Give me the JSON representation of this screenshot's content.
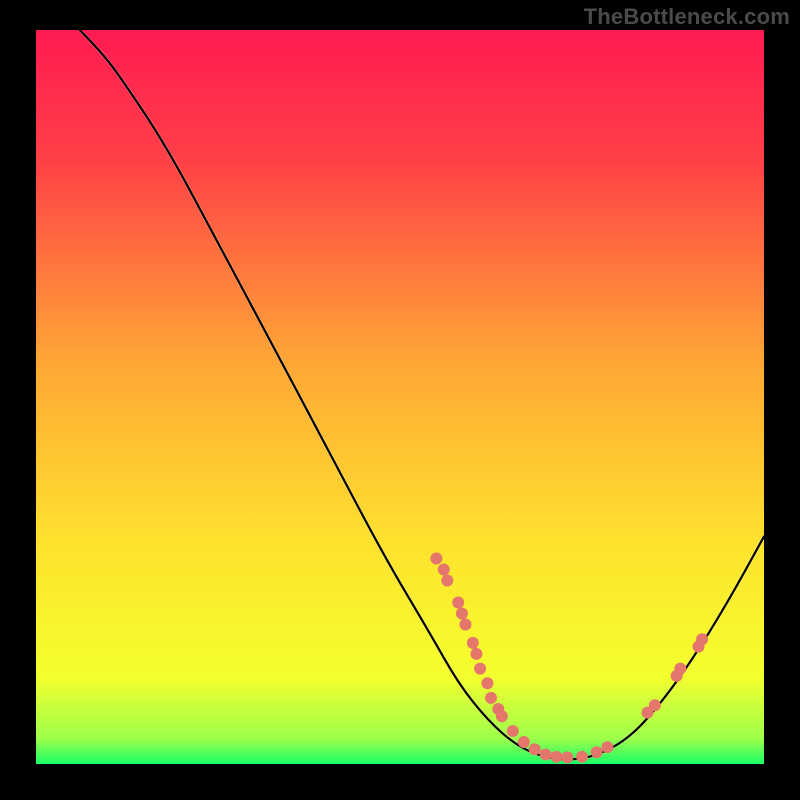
{
  "watermark": "TheBottleneck.com",
  "colors": {
    "dot": "#e4766b",
    "curve": "#000000"
  },
  "chart_data": {
    "type": "line",
    "title": "",
    "xlabel": "",
    "ylabel": "",
    "xlim": [
      0,
      100
    ],
    "ylim": [
      0,
      100
    ],
    "grid": false,
    "legend": false,
    "curve": [
      {
        "x": 6,
        "y": 100
      },
      {
        "x": 9,
        "y": 97
      },
      {
        "x": 12,
        "y": 93
      },
      {
        "x": 18,
        "y": 84
      },
      {
        "x": 25,
        "y": 71
      },
      {
        "x": 32,
        "y": 58
      },
      {
        "x": 40,
        "y": 43
      },
      {
        "x": 48,
        "y": 28
      },
      {
        "x": 54,
        "y": 18
      },
      {
        "x": 58,
        "y": 11
      },
      {
        "x": 62,
        "y": 6
      },
      {
        "x": 66,
        "y": 2.5
      },
      {
        "x": 70,
        "y": 0.8
      },
      {
        "x": 74,
        "y": 0.5
      },
      {
        "x": 78,
        "y": 1.5
      },
      {
        "x": 82,
        "y": 4
      },
      {
        "x": 86,
        "y": 8.5
      },
      {
        "x": 90,
        "y": 14
      },
      {
        "x": 95,
        "y": 22
      },
      {
        "x": 100,
        "y": 31
      }
    ],
    "points": [
      {
        "x": 55,
        "y": 28
      },
      {
        "x": 56,
        "y": 26.5
      },
      {
        "x": 56.5,
        "y": 25
      },
      {
        "x": 58,
        "y": 22
      },
      {
        "x": 58.5,
        "y": 20.5
      },
      {
        "x": 59,
        "y": 19
      },
      {
        "x": 60,
        "y": 16.5
      },
      {
        "x": 60.5,
        "y": 15
      },
      {
        "x": 61,
        "y": 13
      },
      {
        "x": 62,
        "y": 11
      },
      {
        "x": 62.5,
        "y": 9
      },
      {
        "x": 63.5,
        "y": 7.5
      },
      {
        "x": 64,
        "y": 6.5
      },
      {
        "x": 65.5,
        "y": 4.5
      },
      {
        "x": 67,
        "y": 3
      },
      {
        "x": 68.5,
        "y": 2
      },
      {
        "x": 70,
        "y": 1.3
      },
      {
        "x": 71.5,
        "y": 1
      },
      {
        "x": 73,
        "y": 0.9
      },
      {
        "x": 75,
        "y": 1
      },
      {
        "x": 77,
        "y": 1.6
      },
      {
        "x": 78.5,
        "y": 2.3
      },
      {
        "x": 84,
        "y": 7
      },
      {
        "x": 85,
        "y": 8
      },
      {
        "x": 88,
        "y": 12
      },
      {
        "x": 88.5,
        "y": 13
      },
      {
        "x": 91,
        "y": 16
      },
      {
        "x": 91.5,
        "y": 17
      }
    ]
  }
}
